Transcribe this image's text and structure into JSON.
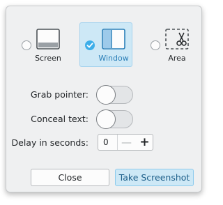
{
  "modes": [
    {
      "label": "Screen",
      "icon": "screen-icon",
      "selected": false
    },
    {
      "label": "Window",
      "icon": "window-icon",
      "selected": true
    },
    {
      "label": "Area",
      "icon": "area-scissors-icon",
      "selected": false
    }
  ],
  "options": {
    "grab_pointer_label": "Grab pointer:",
    "grab_pointer_on": false,
    "conceal_text_label": "Conceal text:",
    "conceal_text_on": false,
    "delay_label": "Delay in seconds:",
    "delay_value": "0",
    "decrement_symbol": "—",
    "increment_symbol": "+"
  },
  "buttons": {
    "close_label": "Close",
    "take_label": "Take Screenshot"
  },
  "colors": {
    "accent": "#3daee9",
    "selected_bg": "#cde8f6",
    "dialog_bg": "#eff0f1"
  }
}
